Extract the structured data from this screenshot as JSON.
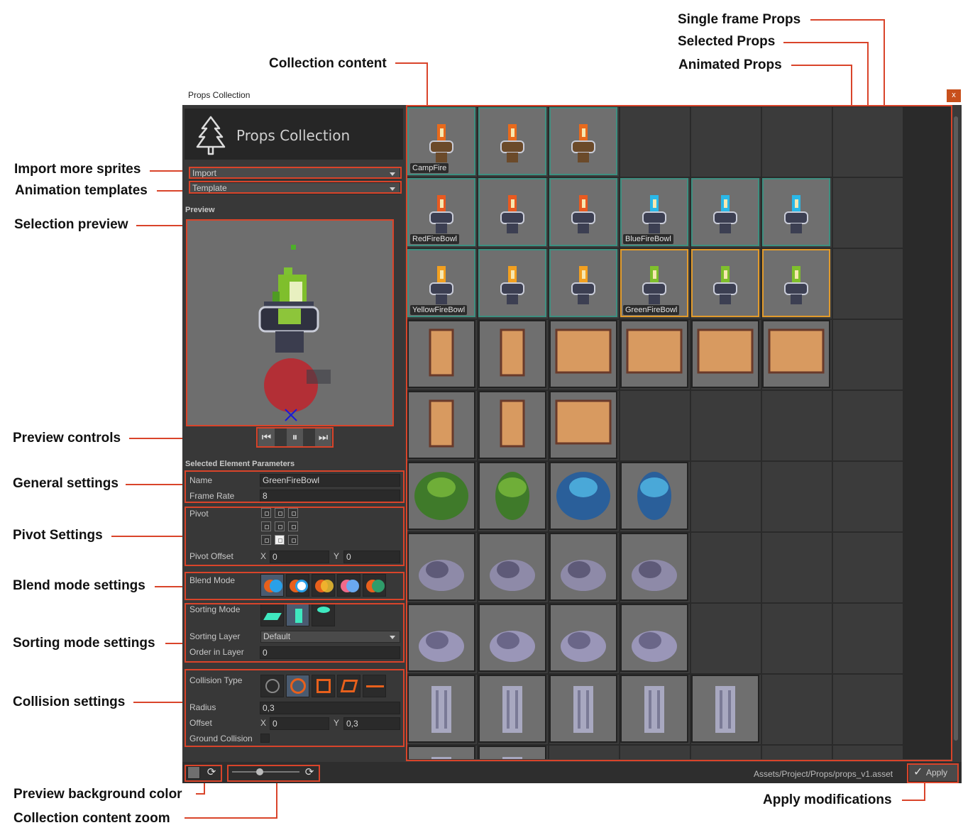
{
  "window": {
    "title": "Props Collection",
    "close": "x"
  },
  "header": {
    "title": "Props Collection",
    "icon": "tree-icon"
  },
  "dropdowns": {
    "import": "Import",
    "template": "Template"
  },
  "preview": {
    "label": "Preview",
    "controls": [
      "skip-back-icon",
      "pause-icon",
      "skip-forward-icon"
    ]
  },
  "params": {
    "label": "Selected Element Parameters",
    "name_label": "Name",
    "name_value": "GreenFireBowl",
    "frame_rate_label": "Frame Rate",
    "frame_rate_value": "8",
    "pivot_label": "Pivot",
    "pivot_offset_label": "Pivot Offset",
    "x_label": "X",
    "y_label": "Y",
    "pivot_offset_x": "0",
    "pivot_offset_y": "0",
    "blend_label": "Blend Mode",
    "sorting_mode_label": "Sorting Mode",
    "sorting_layer_label": "Sorting Layer",
    "sorting_layer_value": "Default",
    "order_label": "Order in Layer",
    "order_value": "0",
    "collision_label": "Collision Type",
    "radius_label": "Radius",
    "radius_value": "0,3",
    "offset_label": "Offset",
    "offset_x": "0",
    "offset_y": "0,3",
    "ground_label": "Ground Collision"
  },
  "grid": {
    "rows": [
      [
        "CampFire",
        "",
        ""
      ],
      [
        "RedFireBowl",
        "",
        "",
        "BlueFireBowl",
        "",
        ""
      ],
      [
        "YellowFireBowl",
        "",
        "",
        "GreenFireBowl",
        "",
        ""
      ],
      [
        "",
        "",
        "",
        "",
        "",
        ""
      ],
      [
        "",
        "",
        ""
      ],
      [
        "",
        "",
        "",
        ""
      ],
      [
        "",
        "",
        "",
        ""
      ],
      [
        "",
        "",
        "",
        ""
      ],
      [
        "",
        "",
        "",
        "",
        ""
      ],
      [
        "",
        ""
      ]
    ]
  },
  "bottom": {
    "asset_path": "Assets/Project/Props/props_v1.asset",
    "apply": "Apply"
  },
  "annotations": {
    "single_frame": "Single frame Props",
    "selected": "Selected Props",
    "animated": "Animated Props",
    "collection_content": "Collection content",
    "import_more": "Import more sprites",
    "anim_templates": "Animation templates",
    "selection_preview": "Selection preview",
    "preview_controls": "Preview controls",
    "general_settings": "General settings",
    "pivot_settings": "Pivot Settings",
    "blend_settings": "Blend mode settings",
    "sorting_settings": "Sorting mode settings",
    "collision_settings": "Collision settings",
    "preview_bg": "Preview background color",
    "zoom": "Collection content zoom",
    "apply_mod": "Apply modifications"
  },
  "colors": {
    "accent": "#d9442a",
    "selected": "#e29b2c",
    "animated": "#3d8f80"
  }
}
